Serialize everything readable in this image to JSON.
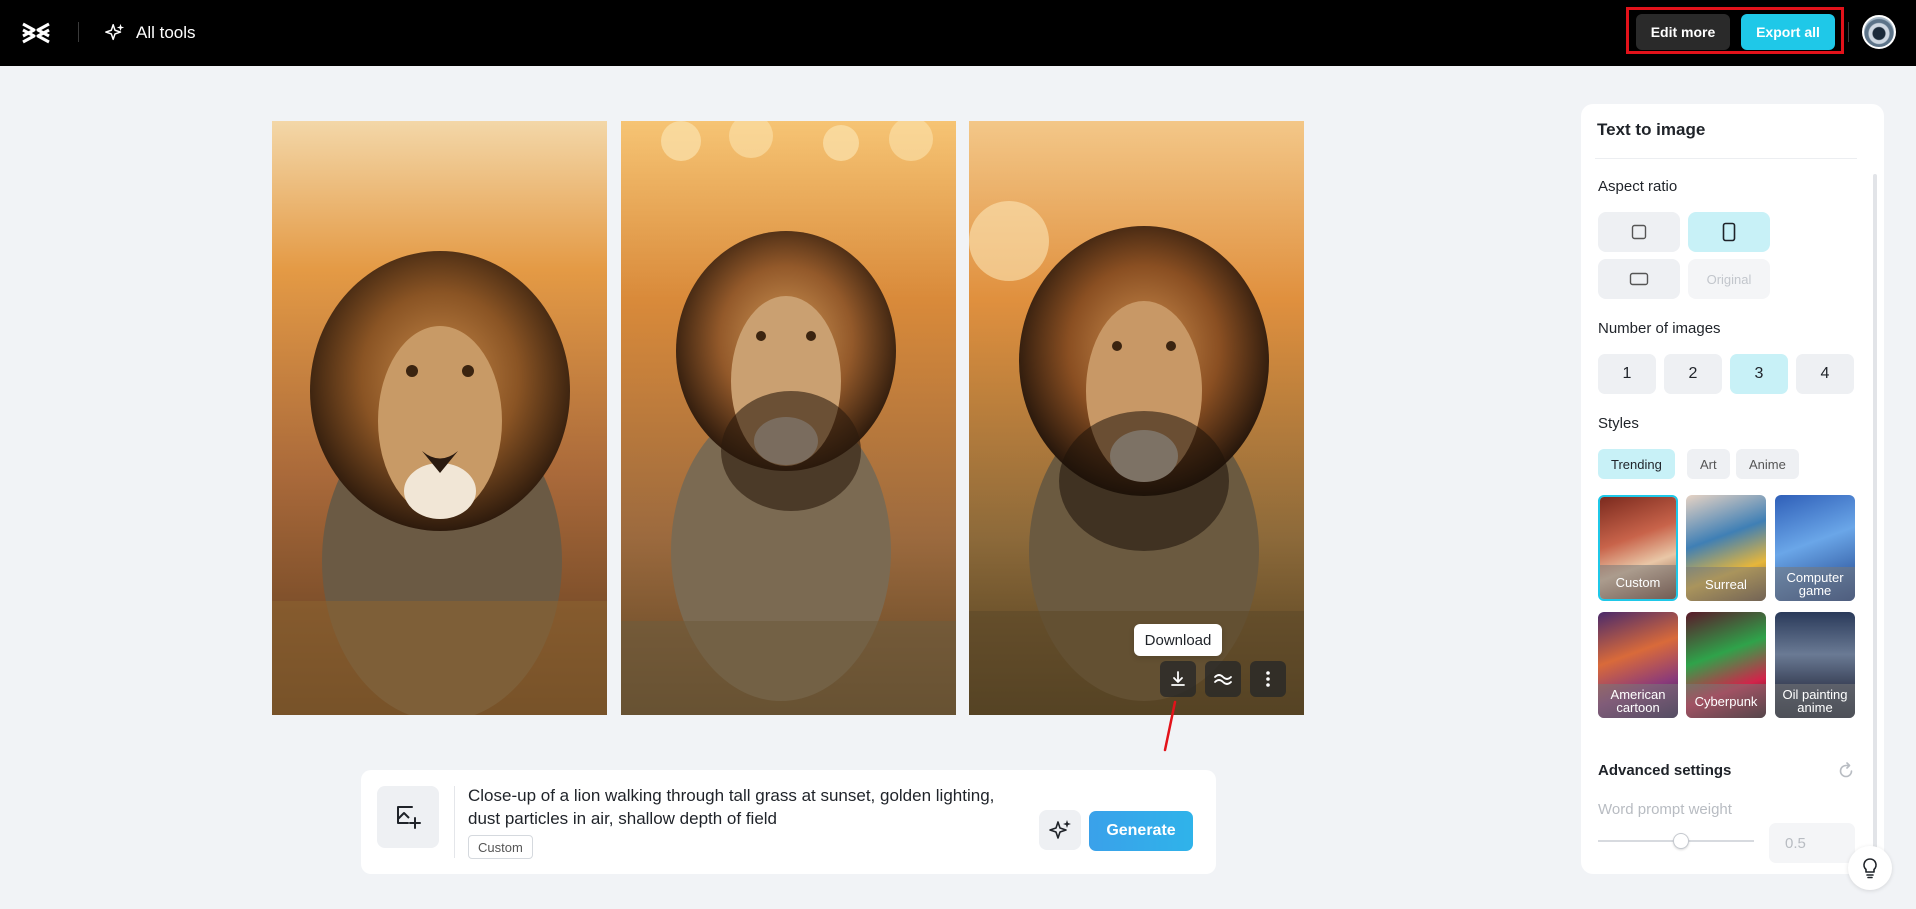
{
  "header": {
    "all_tools_label": "All tools",
    "edit_more_label": "Edit more",
    "export_all_label": "Export all"
  },
  "images": {
    "tooltip": "Download",
    "actions": [
      "download-icon",
      "enhance-icon",
      "more-icon"
    ]
  },
  "prompt": {
    "text": "Close-up of a lion walking through tall grass at sunset, golden lighting, dust particles in air, shallow depth of field",
    "tag": "Custom",
    "generate_label": "Generate"
  },
  "panel": {
    "title": "Text to image",
    "aspect_ratio_label": "Aspect ratio",
    "original_label": "Original",
    "number_label": "Number of images",
    "numbers": [
      "1",
      "2",
      "3",
      "4"
    ],
    "selected_number": "3",
    "styles_label": "Styles",
    "style_tabs": [
      "Trending",
      "Art",
      "Anime"
    ],
    "style_cards": [
      "Custom",
      "Surreal",
      "Computer game",
      "American cartoon",
      "Cyberpunk",
      "Oil painting anime"
    ],
    "advanced_label": "Advanced settings",
    "word_prompt_label": "Word prompt weight",
    "word_prompt_value": "0.5"
  },
  "colors": {
    "accent": "#1fc8e8",
    "selected_bg": "#c8f1f7",
    "highlight": "#e3121a"
  }
}
